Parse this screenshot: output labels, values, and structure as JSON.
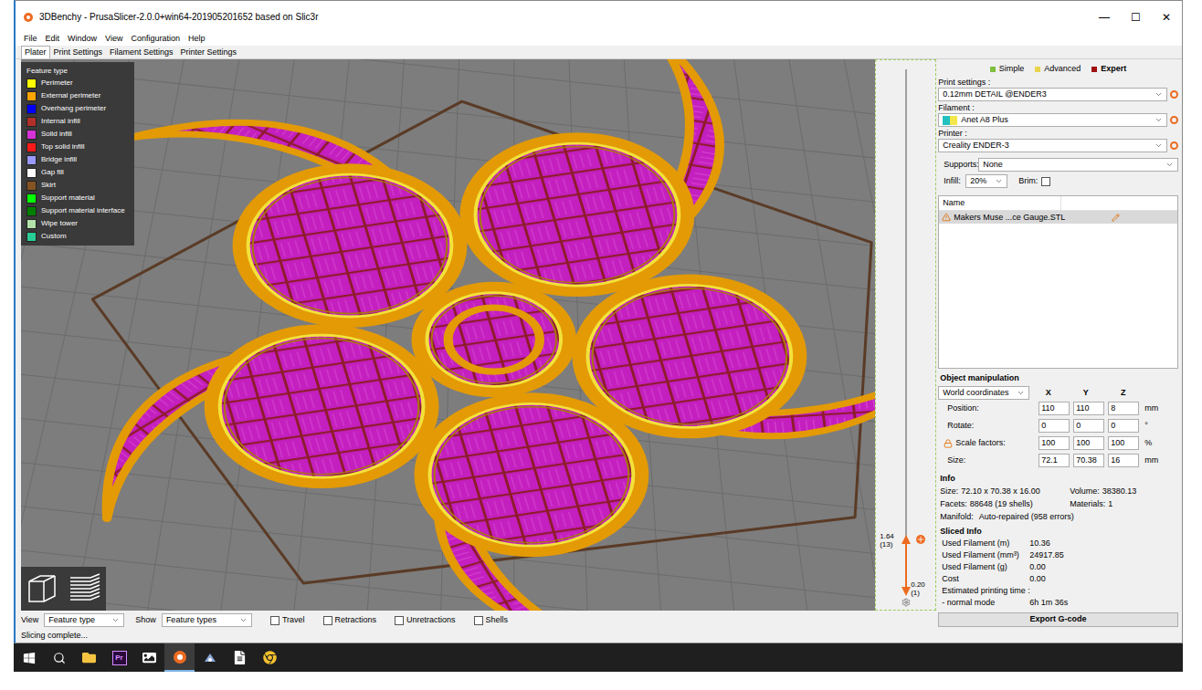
{
  "window": {
    "title": "3DBenchy - PrusaSlicer-2.0.0+win64-201905201652 based on Slic3r",
    "controls": [
      "—",
      "☐",
      "✕"
    ]
  },
  "menu": [
    "File",
    "Edit",
    "Window",
    "View",
    "Configuration",
    "Help"
  ],
  "tabs": [
    {
      "label": "Plater",
      "selected": true
    },
    {
      "label": "Print Settings",
      "selected": false
    },
    {
      "label": "Filament Settings",
      "selected": false
    },
    {
      "label": "Printer Settings",
      "selected": false
    }
  ],
  "legend": {
    "title": "Feature type",
    "items": [
      {
        "label": "Perimeter",
        "color": "#ffff00"
      },
      {
        "label": "External perimeter",
        "color": "#ffa500"
      },
      {
        "label": "Overhang perimeter",
        "color": "#0000ff"
      },
      {
        "label": "Internal infill",
        "color": "#b03029"
      },
      {
        "label": "Solid infill",
        "color": "#d732d7"
      },
      {
        "label": "Top solid infill",
        "color": "#ff1a1a"
      },
      {
        "label": "Bridge infill",
        "color": "#9999ff"
      },
      {
        "label": "Gap fill",
        "color": "#ffffff"
      },
      {
        "label": "Skirt",
        "color": "#845321"
      },
      {
        "label": "Support material",
        "color": "#00ff00"
      },
      {
        "label": "Support material interface",
        "color": "#008000"
      },
      {
        "label": "Wipe tower",
        "color": "#b3e3ab"
      },
      {
        "label": "Custom",
        "color": "#28cc94"
      }
    ]
  },
  "layer_slider": {
    "upper": {
      "value": "1.64",
      "layer": "(13)",
      "level": 0.1
    },
    "lower": {
      "value": "0.20",
      "layer": "(1)",
      "level": 0
    }
  },
  "view_controls": {
    "view": {
      "label": "View",
      "value": "Feature type"
    },
    "show": {
      "label": "Show",
      "value": "Feature types"
    },
    "checkboxes": [
      {
        "label": "Travel",
        "checked": false
      },
      {
        "label": "Retractions",
        "checked": false
      },
      {
        "label": "Unretractions",
        "checked": false
      },
      {
        "label": "Shells",
        "checked": false
      }
    ]
  },
  "mode": [
    {
      "label": "Simple",
      "color": "#7fbf3f",
      "selected": false
    },
    {
      "label": "Advanced",
      "color": "#e8d44d",
      "selected": false
    },
    {
      "label": "Expert",
      "color": "#a01010",
      "selected": true
    }
  ],
  "presets": [
    {
      "label": "Print settings :",
      "value": "0.12mm DETAIL @ENDER3",
      "colors": []
    },
    {
      "label": "Filament :",
      "value": "Anet A8 Plus",
      "colors": [
        "#25c0c0",
        "#f5e74a"
      ]
    },
    {
      "label": "Printer :",
      "value": "Creality ENDER-3",
      "colors": []
    }
  ],
  "supports": {
    "label": "Supports:",
    "value": "None"
  },
  "infill": {
    "label": "Infill:",
    "value": "20%"
  },
  "brim": {
    "label": "Brim:",
    "checked": false
  },
  "object_list": {
    "header": "Name",
    "rows": [
      {
        "name": "Makers Muse ...ce Gauge.STL",
        "warning": true,
        "selected": true
      }
    ]
  },
  "object_manipulation": {
    "title": "Object manipulation",
    "coordinates": "World coordinates",
    "axes": [
      "X",
      "Y",
      "Z"
    ],
    "rows": [
      {
        "label": "Position:",
        "values": [
          "110",
          "110",
          "8"
        ],
        "unit": "mm",
        "locked": false
      },
      {
        "label": "Rotate:",
        "values": [
          "0",
          "0",
          "0"
        ],
        "unit": "°",
        "locked": false
      },
      {
        "label": "Scale factors:",
        "values": [
          "100",
          "100",
          "100"
        ],
        "unit": "%",
        "locked": true
      },
      {
        "label": "Size:",
        "values": [
          "72.1",
          "70.38",
          "16"
        ],
        "unit": "mm",
        "locked": false
      }
    ]
  },
  "info": {
    "title": "Info",
    "lines": [
      [
        {
          "label": "Size:",
          "value": "72.10 x 70.38 x 16.00",
          "warning": false
        },
        {
          "label": "Volume:",
          "value": "38380.13",
          "warning": false
        }
      ],
      [
        {
          "label": "Facets:",
          "value": "88648 (19 shells)",
          "warning": false
        },
        {
          "label": "Materials:",
          "value": "1",
          "warning": false
        }
      ],
      [
        {
          "label": "Manifold:",
          "value": "Auto-repaired (958 errors)",
          "warning": true
        }
      ]
    ]
  },
  "sliced_info": {
    "title": "Sliced Info",
    "rows": [
      {
        "label": "Used Filament (m)",
        "value": "10.36"
      },
      {
        "label": "Used Filament (mm³)",
        "value": "24917.85"
      },
      {
        "label": "Used Filament (g)",
        "value": "0.00"
      },
      {
        "label": "Cost",
        "value": "0.00"
      },
      {
        "label": "Estimated printing time :"
      },
      {
        "label": "- normal mode",
        "value": "6h 1m 36s"
      }
    ]
  },
  "export_button": "Export G-code",
  "status_bar": "Slicing complete...",
  "taskbar": [
    {
      "kind": "start",
      "selected": false
    },
    {
      "kind": "search",
      "selected": false
    },
    {
      "kind": "explorer",
      "selected": false
    },
    {
      "kind": "premiere",
      "label": "Pr",
      "selected": false
    },
    {
      "kind": "photos",
      "selected": false
    },
    {
      "kind": "prusaslicer",
      "selected": true
    },
    {
      "kind": "cura",
      "selected": false
    },
    {
      "kind": "file",
      "selected": false
    },
    {
      "kind": "chrome",
      "selected": false
    }
  ]
}
